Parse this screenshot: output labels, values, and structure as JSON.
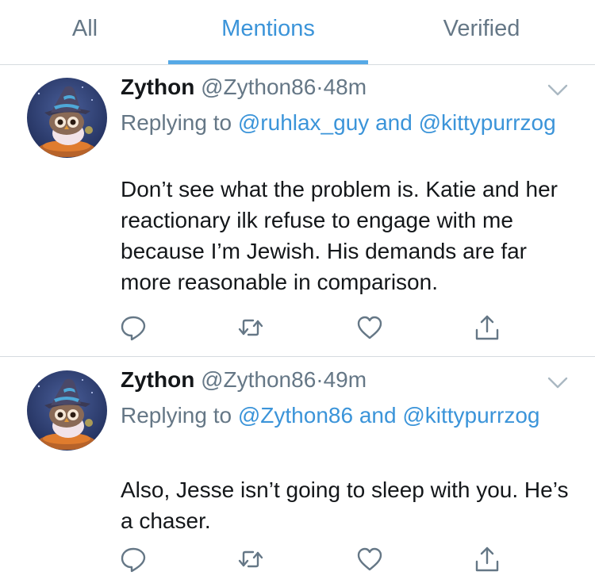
{
  "tabs": [
    {
      "label": "All"
    },
    {
      "label": "Mentions",
      "active": true
    },
    {
      "label": "Verified"
    }
  ],
  "colors": {
    "accent": "#3b94d9",
    "muted": "#657786",
    "text": "#14171a",
    "divider": "#d6dbe0"
  },
  "tweets": [
    {
      "name": "Zython",
      "handle": "@Zython86",
      "separator": "·",
      "time": "48m",
      "replying_prefix": "Replying to",
      "replying_user_1": "@ruhlax_guy",
      "replying_and": "and",
      "replying_user_2": "@kittypurrzog",
      "text": "Don’t see what the problem is. Katie and her reactionary ilk refuse to engage with me because I’m Jewish. His demands are far more reasonable in comparison."
    },
    {
      "name": "Zython",
      "handle": "@Zython86",
      "separator": "·",
      "time": "49m",
      "replying_prefix": "Replying to",
      "replying_user_1": "@Zython86",
      "replying_and": "and",
      "replying_user_2": "@kittypurrzog",
      "text": "Also, Jesse isn’t going to sleep with you. He’s a chaser."
    }
  ],
  "icons": [
    "reply-icon",
    "retweet-icon",
    "like-icon",
    "share-icon",
    "chevron-down-icon"
  ]
}
